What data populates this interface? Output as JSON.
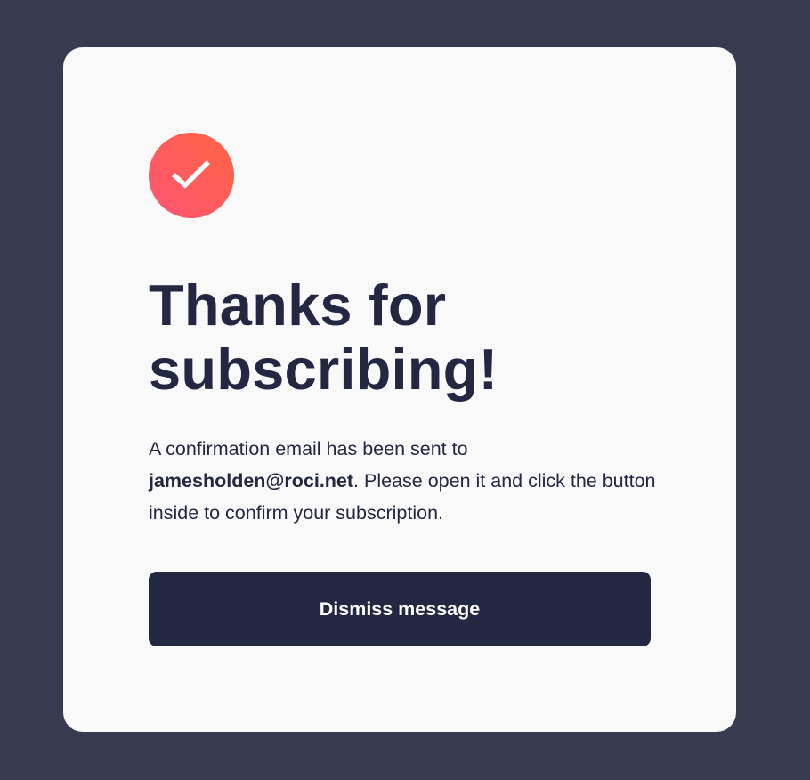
{
  "confirmation": {
    "icon": "checkmark-icon",
    "accent_gradient": [
      "#ff5475",
      "#ff6542"
    ],
    "title": "Thanks for subscribing!",
    "message_before_email": "A confirmation email has been sent to ",
    "email": "jamesholden@roci.net",
    "message_after_email": ". Please open it and click the button inside to confirm your subscription.",
    "dismiss_label": "Dismiss message"
  },
  "colors": {
    "backdrop": "#383a51",
    "card": "#f9f9f9",
    "text": "#232742",
    "button": "#242742",
    "button_text": "#ffffff"
  }
}
